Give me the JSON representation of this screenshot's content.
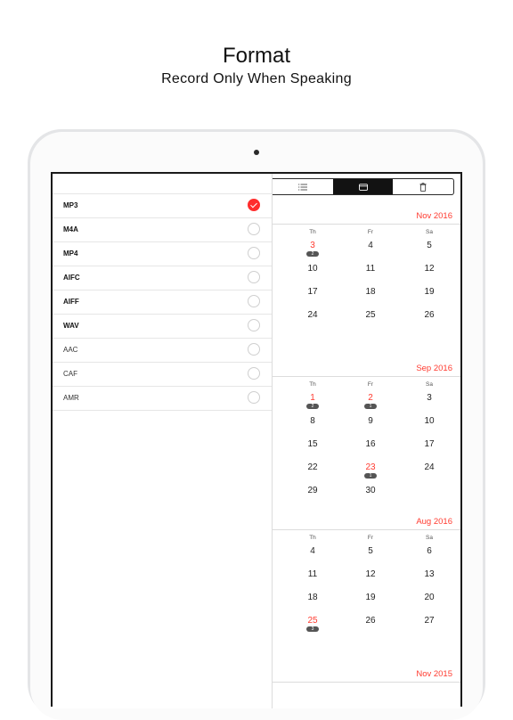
{
  "hero": {
    "title": "Format",
    "subtitle": "Record Only When Speaking"
  },
  "formats": [
    {
      "label": "MP3",
      "bold": true,
      "selected": true
    },
    {
      "label": "M4A",
      "bold": true,
      "selected": false
    },
    {
      "label": "MP4",
      "bold": true,
      "selected": false
    },
    {
      "label": "AIFC",
      "bold": true,
      "selected": false
    },
    {
      "label": "AIFF",
      "bold": true,
      "selected": false
    },
    {
      "label": "WAV",
      "bold": true,
      "selected": false
    },
    {
      "label": "AAC",
      "bold": false,
      "selected": false
    },
    {
      "label": "CAF",
      "bold": false,
      "selected": false
    },
    {
      "label": "AMR",
      "bold": false,
      "selected": false
    }
  ],
  "toolbar": {
    "segments": [
      "list-icon",
      "calendar-icon",
      "trash-icon"
    ],
    "active_index": 1
  },
  "colors": {
    "accent": "#ff3b30",
    "check": "#ff2d2d",
    "segment_active": "#121212"
  },
  "calendar": {
    "weekdays": [
      "Th",
      "Fr",
      "Sa"
    ],
    "months": [
      {
        "title": "Nov 2016",
        "rows": [
          [
            "3",
            "4",
            "5"
          ],
          [
            "10",
            "11",
            "12"
          ],
          [
            "17",
            "18",
            "19"
          ],
          [
            "24",
            "25",
            "26"
          ]
        ],
        "highlights": [
          {
            "row": 0,
            "col": 0,
            "count": "2"
          }
        ]
      },
      {
        "title": "Sep 2016",
        "rows": [
          [
            "1",
            "2",
            "3"
          ],
          [
            "8",
            "9",
            "10"
          ],
          [
            "15",
            "16",
            "17"
          ],
          [
            "22",
            "23",
            "24"
          ],
          [
            "29",
            "30",
            ""
          ]
        ],
        "highlights": [
          {
            "row": 0,
            "col": 0,
            "count": "2"
          },
          {
            "row": 0,
            "col": 1,
            "count": "1"
          },
          {
            "row": 3,
            "col": 1,
            "count": "1"
          }
        ]
      },
      {
        "title": "Aug 2016",
        "rows": [
          [
            "4",
            "5",
            "6"
          ],
          [
            "11",
            "12",
            "13"
          ],
          [
            "18",
            "19",
            "20"
          ],
          [
            "25",
            "26",
            "27"
          ]
        ],
        "highlights": [
          {
            "row": 3,
            "col": 0,
            "count": "3"
          }
        ]
      },
      {
        "title": "Nov 2015",
        "rows": [],
        "highlights": []
      }
    ]
  }
}
